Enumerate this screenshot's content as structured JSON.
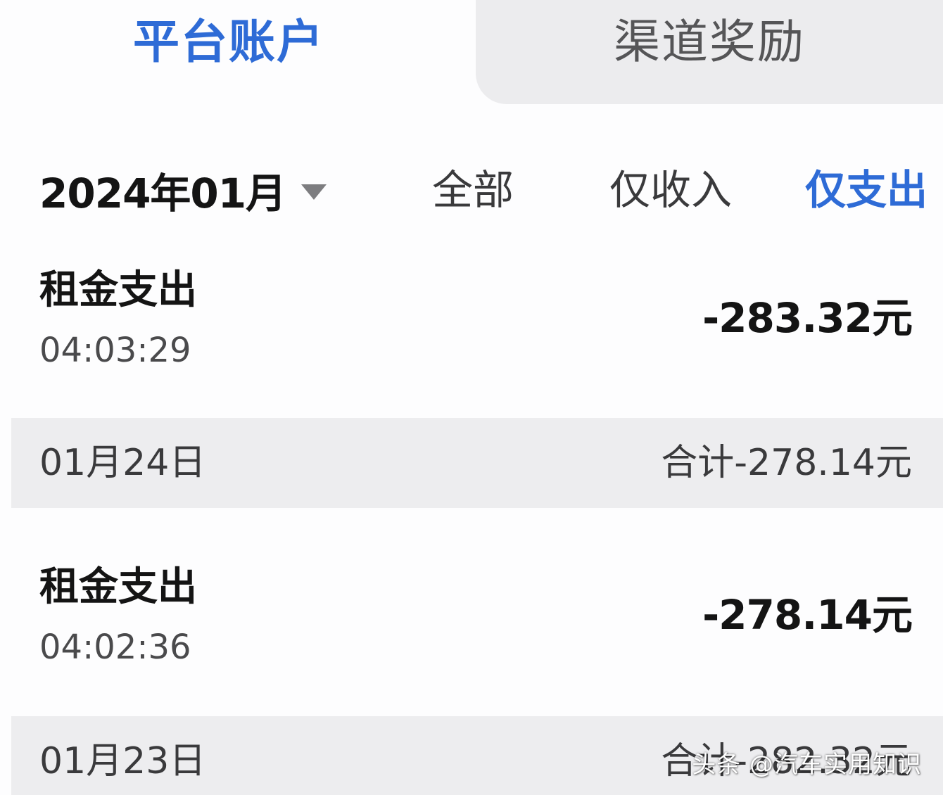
{
  "tabs": [
    {
      "label": "平台账户",
      "active": true
    },
    {
      "label": "渠道奖励",
      "active": false
    }
  ],
  "filter": {
    "month": "2024年01月",
    "options": [
      "全部",
      "仅收入",
      "仅支出"
    ],
    "selected": "仅支出"
  },
  "transactions": [
    {
      "title": "租金支出",
      "time": "04:03:29",
      "amount": "-283.32元"
    },
    {
      "title": "租金支出",
      "time": "04:02:36",
      "amount": "-278.14元"
    }
  ],
  "groups": [
    {
      "date": "01月24日",
      "total": "合计-278.14元"
    },
    {
      "date": "01月23日",
      "total": "合计-282.32元"
    }
  ],
  "watermark": "头条 @汽车实用知识",
  "colors": {
    "accent": "#2e6bd6",
    "text": "#141414",
    "muted": "#4a4a4c",
    "group_bg": "#ededef",
    "inactive_tab_bg": "#ececee"
  }
}
